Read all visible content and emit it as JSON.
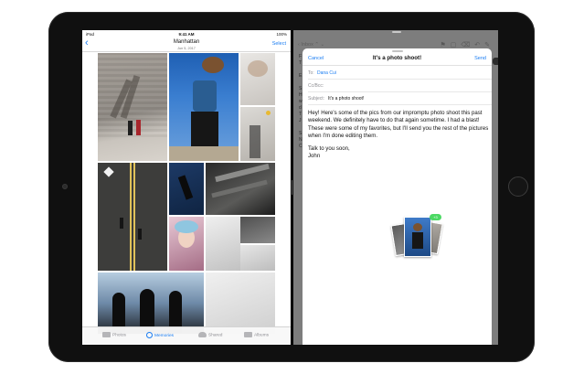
{
  "photos": {
    "status": {
      "carrier": "iPad",
      "time": "9:41 AM",
      "battery": "100%"
    },
    "nav": {
      "title": "Manhattan",
      "date": "Jun 5, 2017",
      "select_label": "Select"
    },
    "tabs": [
      {
        "label": "Photos",
        "icon": "photos-icon",
        "active": false
      },
      {
        "label": "Memories",
        "icon": "memories-icon",
        "active": true
      },
      {
        "label": "Shared",
        "icon": "shared-cloud-icon",
        "active": false
      },
      {
        "label": "Albums",
        "icon": "albums-icon",
        "active": false
      }
    ]
  },
  "mail": {
    "toolbar": {
      "inbox_label": "Inbox",
      "icons": [
        "chevron-up-icon",
        "chevron-down-icon",
        "flag-icon",
        "folder-icon",
        "trash-icon",
        "reply-icon",
        "compose-icon"
      ]
    },
    "side_letters": "F\nT\n\nE\n\nS\nH\nw\nd\nT\nJ\n\nS\nN\nC",
    "compose": {
      "cancel_label": "Cancel",
      "title": "It's a photo shoot!",
      "send_label": "Send",
      "to_label": "To:",
      "to_value": "Dana Cui",
      "cc_label": "Cc/Bcc:",
      "subject_label": "Subject:",
      "subject_value": "It's a photo shoot!",
      "body_p1": "Hey! Here's some of the pics from our impromptu photo shoot this past weekend. We definitely have to do that again sometime. I had a blast! These were some of my favorites, but I'll send you the rest of the pictures when I'm done editing them.",
      "body_p2": "Talk to you soon,",
      "signature": "John",
      "attachment_badge": "+3"
    }
  },
  "colors": {
    "accent": "#1a7df2",
    "device": "#101010"
  }
}
